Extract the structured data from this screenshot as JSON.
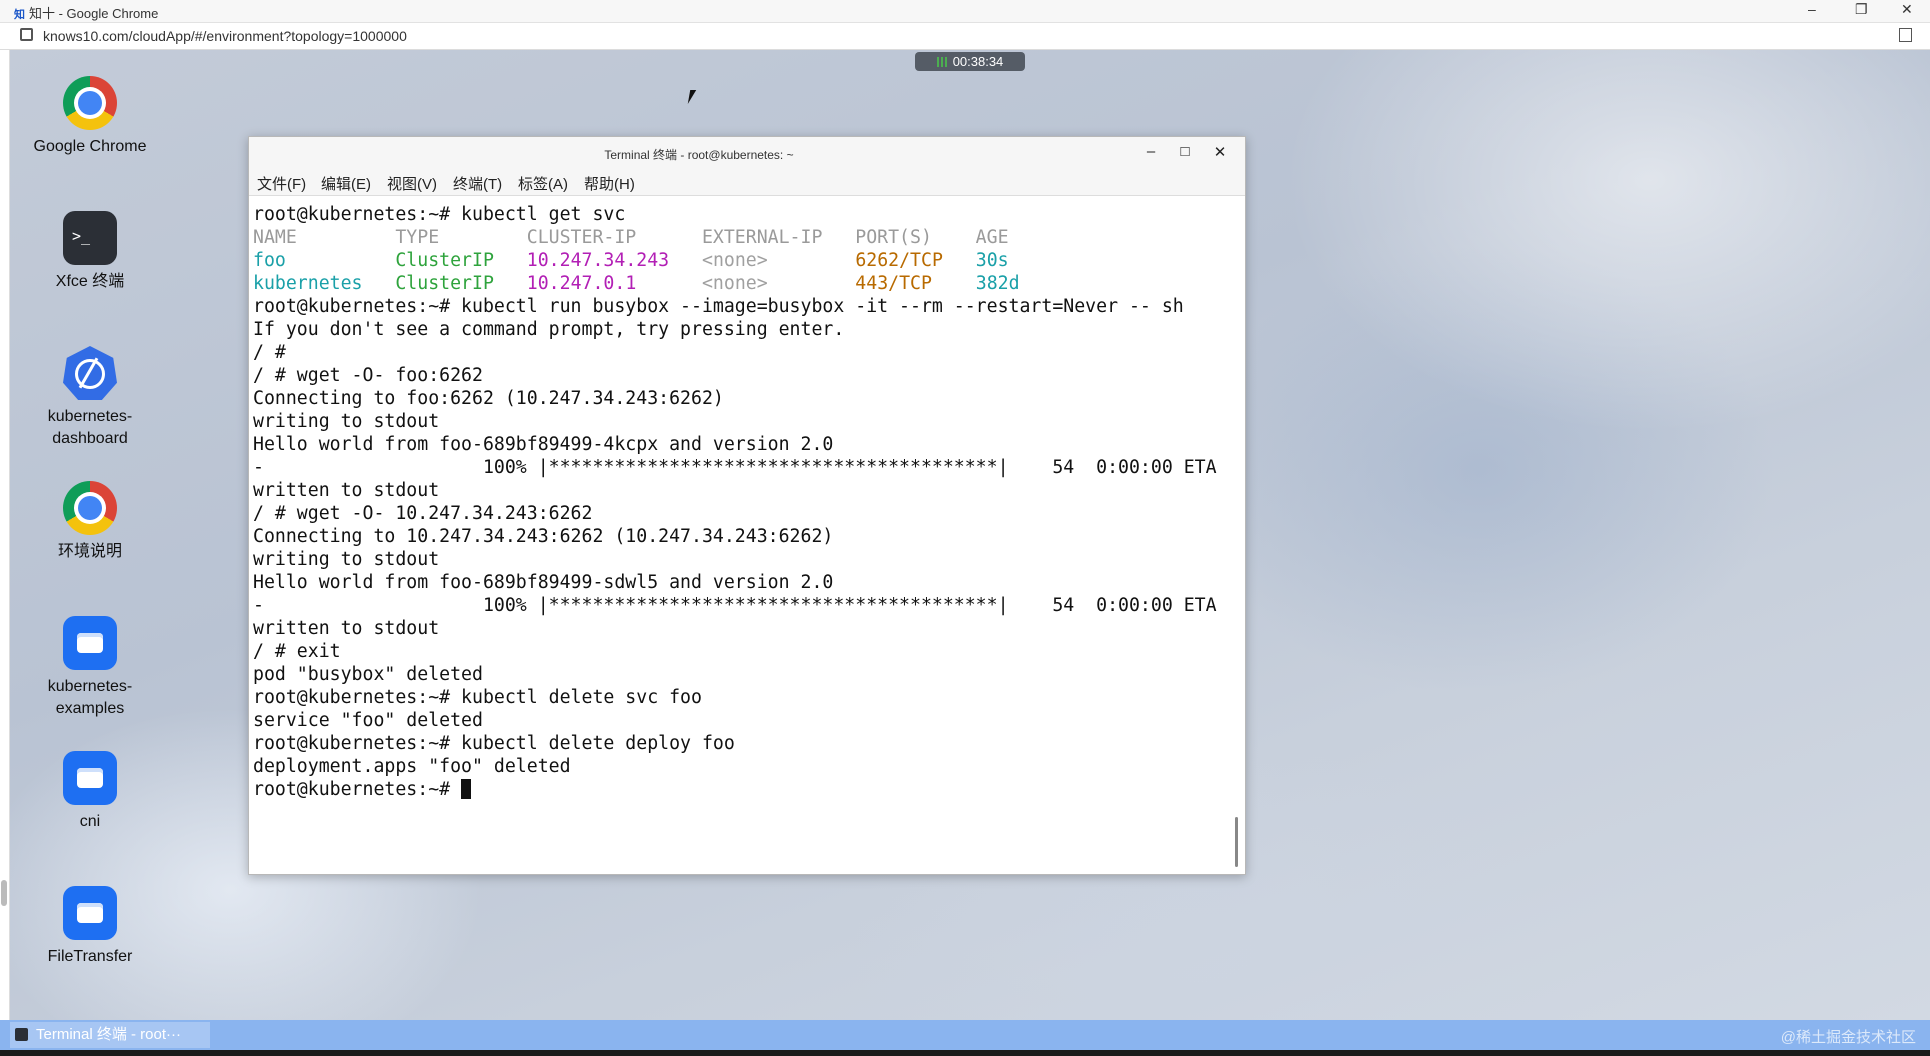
{
  "browser": {
    "title": "知十 - Google Chrome",
    "url": "knows10.com/cloudApp/#/environment?topology=1000000",
    "controls": {
      "minimize": "–",
      "restore": "❐",
      "close": "✕"
    }
  },
  "session_timer": "00:38:34",
  "desktop_icons": [
    {
      "label": "Google Chrome",
      "icon": "chrome-icon"
    },
    {
      "label": "Xfce 终端",
      "icon": "terminal-icon",
      "glyph": ">_"
    },
    {
      "label": "kubernetes-\ndashboard",
      "icon": "kubernetes-icon"
    },
    {
      "label": "环境说明",
      "icon": "chrome-icon"
    },
    {
      "label": "kubernetes-\nexamples",
      "icon": "folder-icon"
    },
    {
      "label": "cni",
      "icon": "folder-icon"
    },
    {
      "label": "FileTransfer",
      "icon": "folder-icon"
    }
  ],
  "terminal": {
    "title": "Terminal 终端 - root@kubernetes: ~",
    "controls": {
      "minimize": "–",
      "maximize": "□",
      "close": "✕"
    },
    "menu": [
      "文件(F)",
      "编辑(E)",
      "视图(V)",
      "终端(T)",
      "标签(A)",
      "帮助(H)"
    ],
    "lines": {
      "l1": "root@kubernetes:~# kubectl get svc",
      "svc_header": "NAME         TYPE        CLUSTER-IP      EXTERNAL-IP   PORT(S)    AGE",
      "row1": {
        "name": "foo",
        "name_pad": "          ",
        "type": "ClusterIP",
        "pad1": "   ",
        "ip": "10.247.34.243",
        "pad2": "   ",
        "ext": "<none>",
        "pad3": "        ",
        "port": "6262/TCP",
        "pad4": "   ",
        "age": "30s"
      },
      "row2": {
        "name": "kubernetes",
        "name_pad": "   ",
        "type": "ClusterIP",
        "pad1": "   ",
        "ip": "10.247.0.1",
        "pad2": "      ",
        "ext": "<none>",
        "pad3": "        ",
        "port": "443/TCP",
        "pad4": "    ",
        "age": "382d"
      },
      "l5": "root@kubernetes:~# kubectl run busybox --image=busybox -it --rm --restart=Never -- sh",
      "l6": "If you don't see a command prompt, try pressing enter.",
      "l7": "/ #",
      "l8": "/ # wget -O- foo:6262",
      "l9": "Connecting to foo:6262 (10.247.34.243:6262)",
      "l10": "writing to stdout",
      "l11": "Hello world from foo-689bf89499-4kcpx and version 2.0",
      "l12": "-                    100% |*****************************************|    54  0:00:00 ETA",
      "l13": "written to stdout",
      "l14": "/ # wget -O- 10.247.34.243:6262",
      "l15": "Connecting to 10.247.34.243:6262 (10.247.34.243:6262)",
      "l16": "writing to stdout",
      "l17": "Hello world from foo-689bf89499-sdwl5 and version 2.0",
      "l18": "-                    100% |*****************************************|    54  0:00:00 ETA",
      "l19": "written to stdout",
      "l20": "/ # exit",
      "l21": "pod \"busybox\" deleted",
      "l22": "root@kubernetes:~# kubectl delete svc foo",
      "l23": "service \"foo\" deleted",
      "l24": "root@kubernetes:~# kubectl delete deploy foo",
      "l25": "deployment.apps \"foo\" deleted",
      "prompt": "root@kubernetes:~# "
    }
  },
  "taskbar": {
    "task_label": "Terminal 终端 - root···",
    "watermark": "@稀土掘金技术社区"
  },
  "colors": {
    "svc_name": "#1aa0a8",
    "cluster_ip_type": "#2ea33c",
    "cluster_ip": "#b21fb5",
    "port": "#b86a00",
    "taskbar": "#8ab4ef"
  }
}
